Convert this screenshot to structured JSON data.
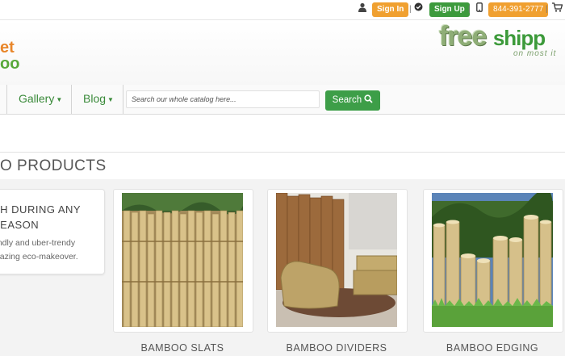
{
  "topbar": {
    "sign_in": "Sign In",
    "sign_up": "Sign Up",
    "phone": "844-391-2777",
    "icons": [
      "user-icon",
      "check-circle-icon",
      "phone-icon",
      "cart-icon"
    ]
  },
  "logo": {
    "line1": "et",
    "line2": "oo"
  },
  "banner": {
    "big1": "free",
    "big2": "shipp",
    "small": "on most it"
  },
  "nav": {
    "gallery": "Gallery",
    "blog": "Blog",
    "search_placeholder": "Search our whole catalog here...",
    "search_button": "Search"
  },
  "section": {
    "title": "O PRODUCTS"
  },
  "promo": {
    "heading": "SH DURING ANY SEASON",
    "text": "endly and uber-trendy mazing eco-makeover."
  },
  "products": [
    {
      "label": "BAMBOO SLATS"
    },
    {
      "label": "BAMBOO DIVIDERS"
    },
    {
      "label": "BAMBOO EDGING"
    }
  ],
  "colors": {
    "accent_orange": "#f0a030",
    "accent_green": "#3d9e48",
    "nav_link": "#3a8a3a"
  }
}
